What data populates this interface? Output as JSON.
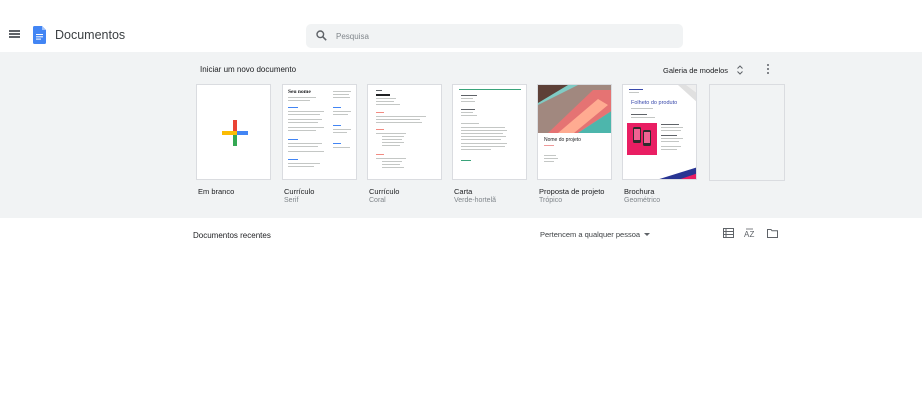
{
  "header": {
    "app_title": "Documentos",
    "search_placeholder": "Pesquisa"
  },
  "gallery": {
    "title": "Iniciar um novo documento",
    "gallery_link": "Galeria de modelos",
    "templates": [
      {
        "name": "Em branco",
        "subtitle": ""
      },
      {
        "name": "Currículo",
        "subtitle": "Serif",
        "preview_heading": "Seu nome"
      },
      {
        "name": "Currículo",
        "subtitle": "Coral"
      },
      {
        "name": "Carta",
        "subtitle": "Verde-hortelã"
      },
      {
        "name": "Proposta de projeto",
        "subtitle": "Trópico",
        "preview_heading": "Nome do projeto"
      },
      {
        "name": "Brochura",
        "subtitle": "Geométrico",
        "preview_heading": "Folheto do produto"
      }
    ]
  },
  "recent": {
    "title": "Documentos recentes",
    "owner_filter": "Pertencem a qualquer pessoa"
  },
  "colors": {
    "docs_blue": "#4285f4",
    "gallery_bg": "#f1f3f4",
    "google_red": "#ea4335",
    "google_yellow": "#fbbc04",
    "google_green": "#34a853",
    "brochure_pink": "#e91e63"
  },
  "icons": [
    "menu-icon",
    "docs-logo",
    "search-icon",
    "unfold-icon",
    "more-vert-icon",
    "list-view-icon",
    "sort-az-icon",
    "folder-icon",
    "plus-icon"
  ]
}
